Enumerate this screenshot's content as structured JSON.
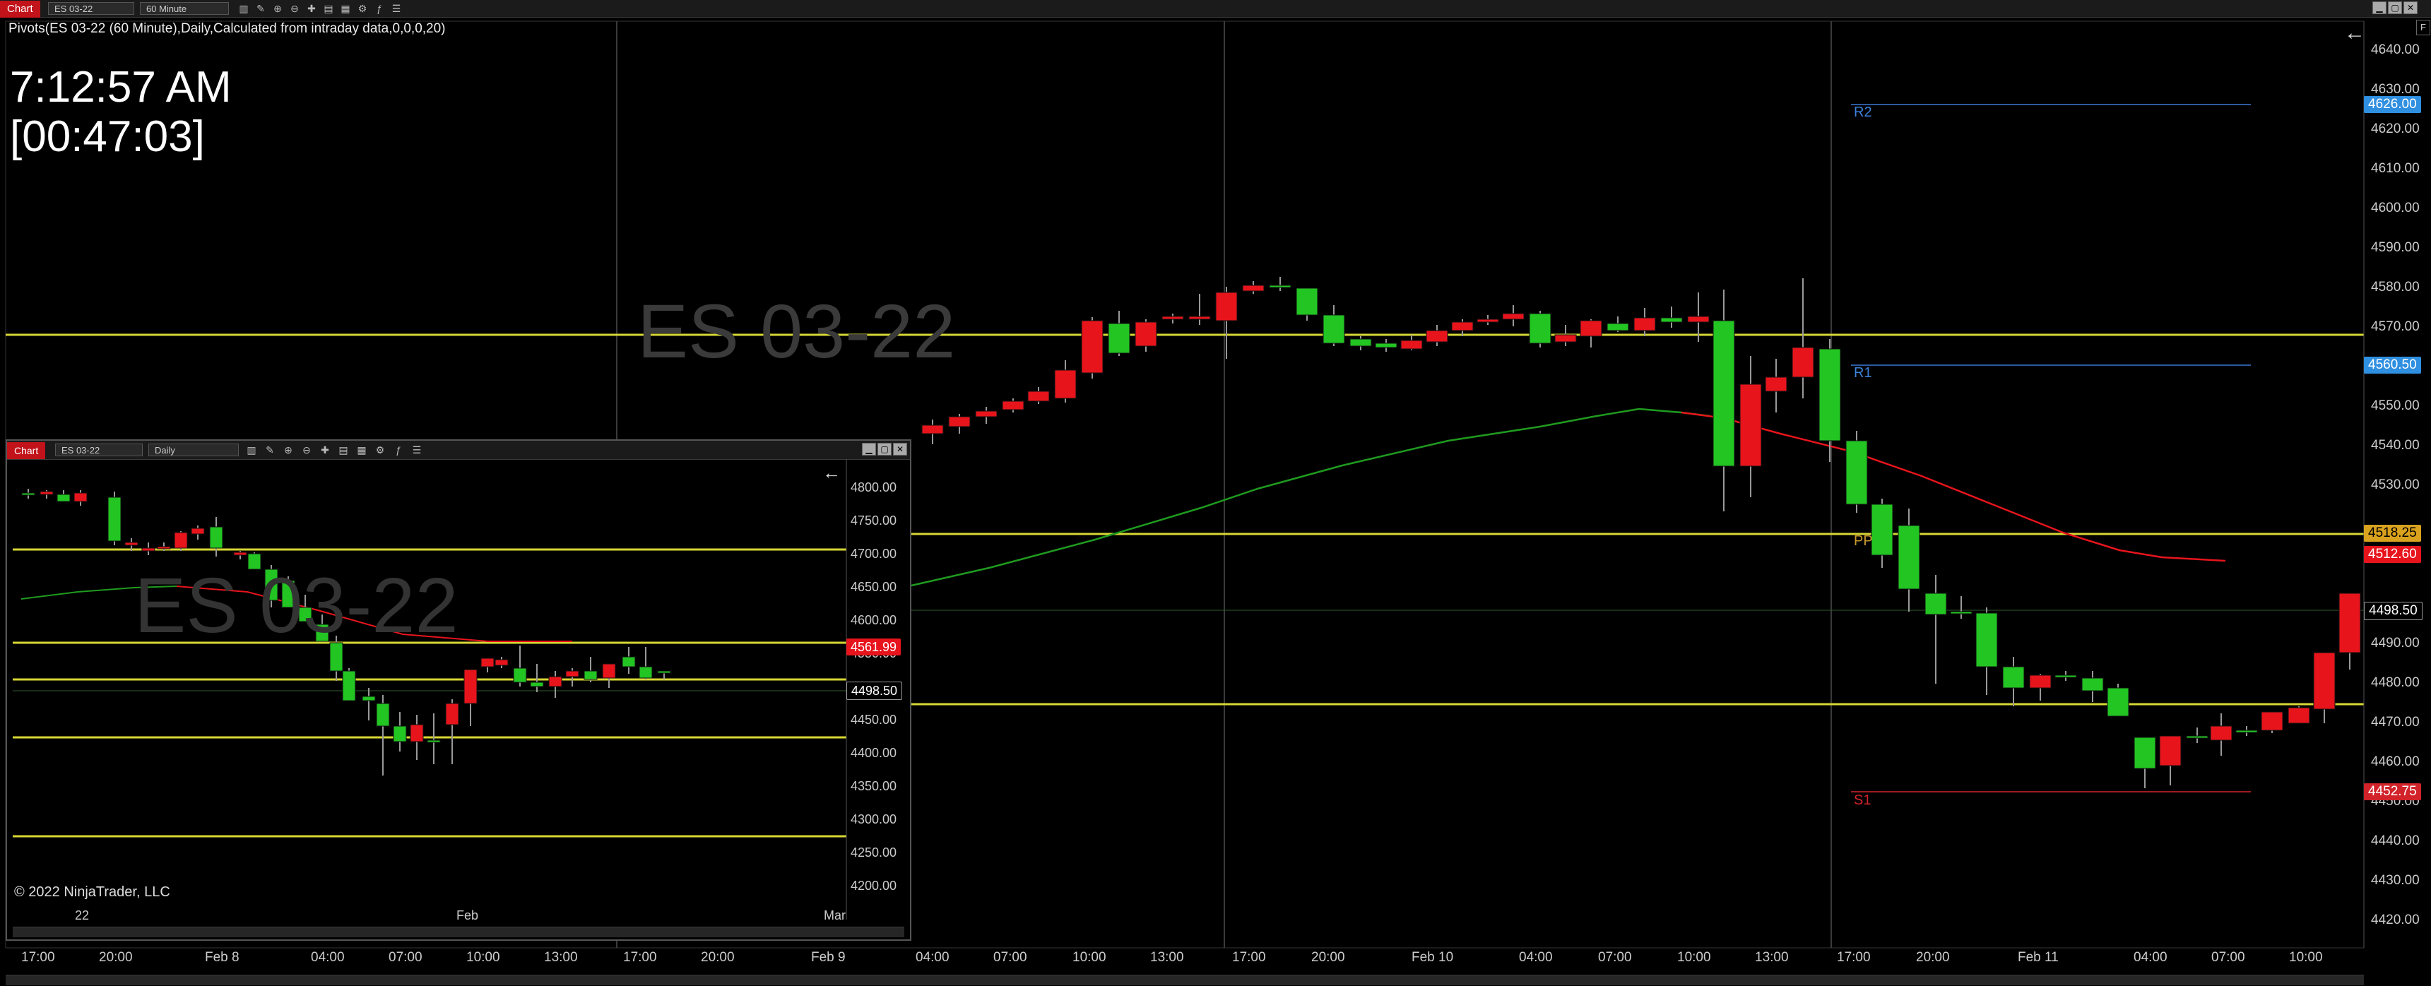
{
  "topbar": {
    "chart_tab": "Chart",
    "instrument": "ES 03-22",
    "interval": "60 Minute",
    "tools": [
      "bars-icon",
      "pencil-icon",
      "zoom-in-icon",
      "zoom-out-icon",
      "crosshair-icon",
      "data-box-icon",
      "template-icon",
      "strategy-icon",
      "indicator-icon",
      "properties-icon"
    ],
    "window_buttons": [
      "▁",
      "▢",
      "✕"
    ],
    "side_button": "F"
  },
  "main": {
    "indicator_label": "Pivots(ES 03-22 (60 Minute),Daily,Calculated from intraday data,0,0,0,20)",
    "clock": "7:12:57 AM",
    "countdown": "[00:47:03]",
    "watermark": "ES 03-22",
    "back_arrow": "←",
    "pivot_labels": {
      "r2": "R2",
      "r1": "R1",
      "pp": "PP",
      "s1": "S1"
    },
    "price_axis": [
      "4640.00",
      "4630.00",
      "4620.00",
      "4610.00",
      "4600.00",
      "4590.00",
      "4580.00",
      "4570.00",
      "4560.00",
      "4550.00",
      "4540.00",
      "4530.00",
      "4490.00",
      "4480.00",
      "4470.00",
      "4460.00",
      "4450.00",
      "4440.00",
      "4430.00",
      "4420.00"
    ],
    "badges": {
      "r2": "4626.00",
      "r1": "4560.50",
      "pp": "4518.25",
      "ema": "4512.60",
      "last": "4498.50",
      "s1": "4452.75"
    },
    "time_axis": [
      "17:00",
      "20:00",
      "Feb 8",
      "04:00",
      "07:00",
      "10:00",
      "13:00",
      "17:00",
      "20:00",
      "Feb 9",
      "04:00",
      "07:00",
      "10:00",
      "13:00",
      "17:00",
      "20:00",
      "Feb 10",
      "04:00",
      "07:00",
      "10:00",
      "13:00",
      "17:00",
      "20:00",
      "Feb 11",
      "04:00",
      "07:00",
      "10:00"
    ],
    "colors": {
      "bull": "#22c522",
      "bear": "#e8141c",
      "pivot": "#d7d735",
      "r_label": "#3c82dc",
      "pp_label": "#c99a2e",
      "s1_label": "#d2232a",
      "ema": "#e8141c",
      "sma": "#1f9a1f"
    }
  },
  "inset": {
    "chart_tab": "Chart",
    "instrument": "ES 03-22",
    "interval": "Daily",
    "watermark": "ES 03-22",
    "back_arrow": "←",
    "copyright": "© 2022 NinjaTrader, LLC",
    "price_axis": [
      "4800.00",
      "4750.00",
      "4700.00",
      "4650.00",
      "4600.00",
      "4550.00",
      "4450.00",
      "4400.00",
      "4350.00",
      "4300.00",
      "4250.00",
      "4200.00"
    ],
    "badges": {
      "ema": "4561.99",
      "last": "4498.50"
    },
    "time_axis": [
      "22",
      "Feb",
      "Mar"
    ]
  }
}
